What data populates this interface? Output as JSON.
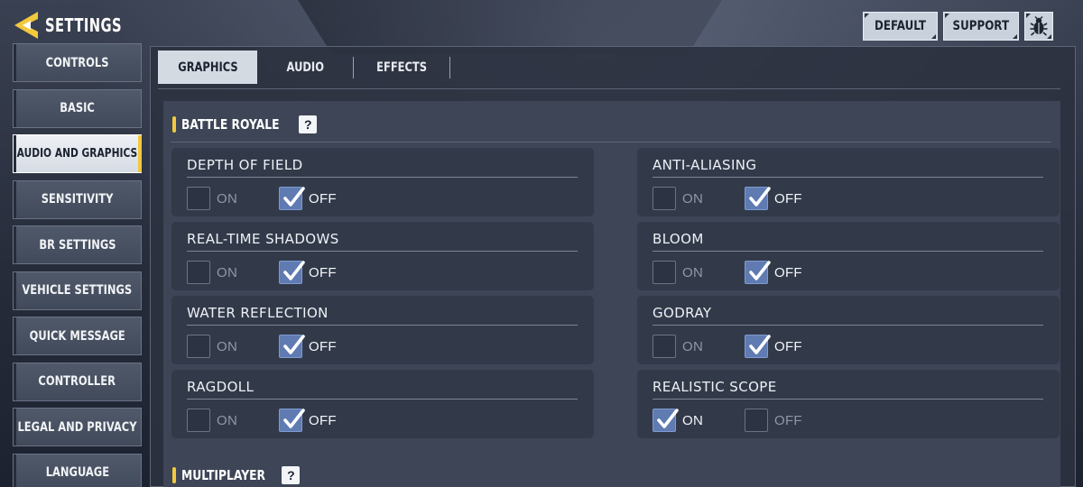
{
  "header": {
    "title": "SETTINGS"
  },
  "top_actions": {
    "default_label": "DEFAULT",
    "support_label": "SUPPORT"
  },
  "sidebar": {
    "items": [
      {
        "label": "CONTROLS"
      },
      {
        "label": "BASIC"
      },
      {
        "label": "AUDIO AND GRAPHICS"
      },
      {
        "label": "SENSITIVITY"
      },
      {
        "label": "BR SETTINGS"
      },
      {
        "label": "VEHICLE SETTINGS"
      },
      {
        "label": "QUICK MESSAGE"
      },
      {
        "label": "CONTROLLER"
      },
      {
        "label": "LEGAL AND PRIVACY"
      },
      {
        "label": "LANGUAGE"
      }
    ],
    "active_index": 2
  },
  "tabs": [
    {
      "label": "GRAPHICS"
    },
    {
      "label": "AUDIO"
    },
    {
      "label": "EFFECTS"
    }
  ],
  "sections": [
    {
      "title": "BATTLE ROYALE",
      "options": [
        {
          "label": "DEPTH OF FIELD",
          "on_label": "ON",
          "off_label": "OFF",
          "value": "OFF"
        },
        {
          "label": "ANTI-ALIASING",
          "on_label": "ON",
          "off_label": "OFF",
          "value": "OFF"
        },
        {
          "label": "REAL-TIME SHADOWS",
          "on_label": "ON",
          "off_label": "OFF",
          "value": "OFF"
        },
        {
          "label": "BLOOM",
          "on_label": "ON",
          "off_label": "OFF",
          "value": "OFF"
        },
        {
          "label": "WATER REFLECTION",
          "on_label": "ON",
          "off_label": "OFF",
          "value": "OFF"
        },
        {
          "label": "GODRAY",
          "on_label": "ON",
          "off_label": "OFF",
          "value": "OFF"
        },
        {
          "label": "RAGDOLL",
          "on_label": "ON",
          "off_label": "OFF",
          "value": "OFF"
        },
        {
          "label": "REALISTIC SCOPE",
          "on_label": "ON",
          "off_label": "OFF",
          "value": "ON"
        }
      ]
    },
    {
      "title": "MULTIPLAYER"
    }
  ],
  "icons": {
    "help": "?",
    "back": "back-arrow-icon",
    "bug": "bug-icon"
  },
  "colors": {
    "accent": "#f2c83c",
    "checkbox_checked": "#5f7bb2",
    "panel_bg": "#2c3240"
  }
}
